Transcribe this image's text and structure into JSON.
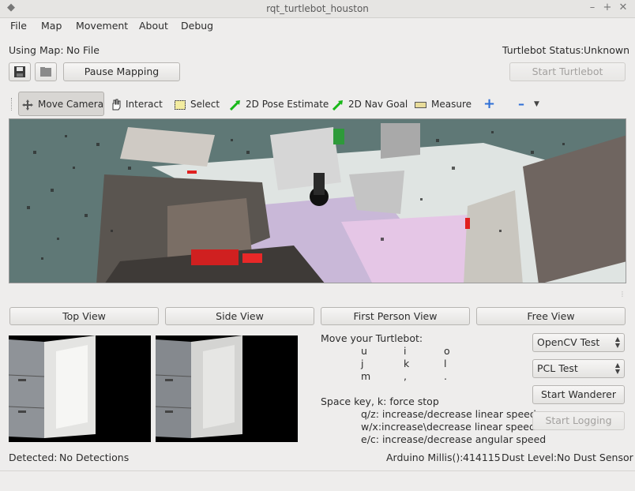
{
  "window": {
    "title": "rqt_turtlebot_houston"
  },
  "menu": [
    "File",
    "Map",
    "Movement",
    "About",
    "Debug"
  ],
  "map_info": {
    "label": "Using Map:",
    "value": "No File"
  },
  "status": {
    "label": "Turtlebot Status:",
    "value": "Unknown"
  },
  "buttons": {
    "pause": "Pause Mapping",
    "start_turtlebot": "Start Turtlebot"
  },
  "tools": [
    "Move Camera",
    "Interact",
    "Select",
    "2D Pose Estimate",
    "2D Nav Goal",
    "Measure"
  ],
  "views": [
    "Top View",
    "Side View",
    "First Person View",
    "Free View"
  ],
  "instructions": {
    "title": "Move your Turtlebot:",
    "keys": [
      [
        "u",
        "i",
        "o"
      ],
      [
        "j",
        "k",
        "l"
      ],
      [
        "m",
        ",",
        "."
      ]
    ],
    "stop": "Space key, k: force stop",
    "lines": [
      "q/z: increase/decrease linear speed",
      "w/x:increase\\decrease linear speed",
      "e/c: increase/decrease angular speed"
    ]
  },
  "side": {
    "combo1": "OpenCV Test",
    "combo2": "PCL Test",
    "wanderer": "Start Wanderer",
    "logging": "Start Logging"
  },
  "footer": {
    "detected_label": "Detected:",
    "detected_value": "No Detections",
    "arduino_label": "Arduino Millis():",
    "arduino_value": "414115",
    "dust_label": "Dust Level:",
    "dust_value": "No Dust Sensor"
  },
  "colors": {
    "accent": "#2f6fd6",
    "viewport": "#5d7674"
  }
}
